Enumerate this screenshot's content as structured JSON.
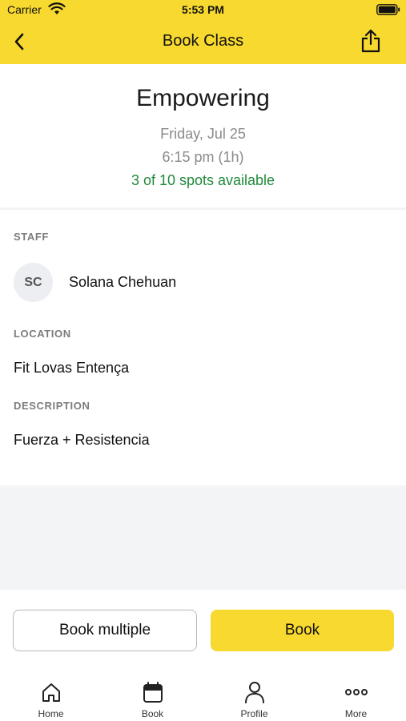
{
  "status_bar": {
    "carrier": "Carrier",
    "time": "5:53 PM"
  },
  "nav": {
    "title": "Book Class"
  },
  "class": {
    "name": "Empowering",
    "date": "Friday, Jul 25",
    "time": "6:15 pm (1h)",
    "spots": "3 of 10 spots available"
  },
  "staff": {
    "label": "STAFF",
    "initials": "SC",
    "name": "Solana Chehuan"
  },
  "location": {
    "label": "LOCATION",
    "value": "Fit Lovas Entença"
  },
  "description": {
    "label": "DESCRIPTION",
    "value": "Fuerza + Resistencia"
  },
  "actions": {
    "book_multiple": "Book multiple",
    "book": "Book"
  },
  "tabs": [
    {
      "label": "Home",
      "icon": "home-icon"
    },
    {
      "label": "Book",
      "icon": "calendar-icon"
    },
    {
      "label": "Profile",
      "icon": "person-icon"
    },
    {
      "label": "More",
      "icon": "more-icon"
    }
  ],
  "colors": {
    "accent": "#f8d92f",
    "available": "#1e8a3a",
    "muted": "#8a8a8a"
  }
}
